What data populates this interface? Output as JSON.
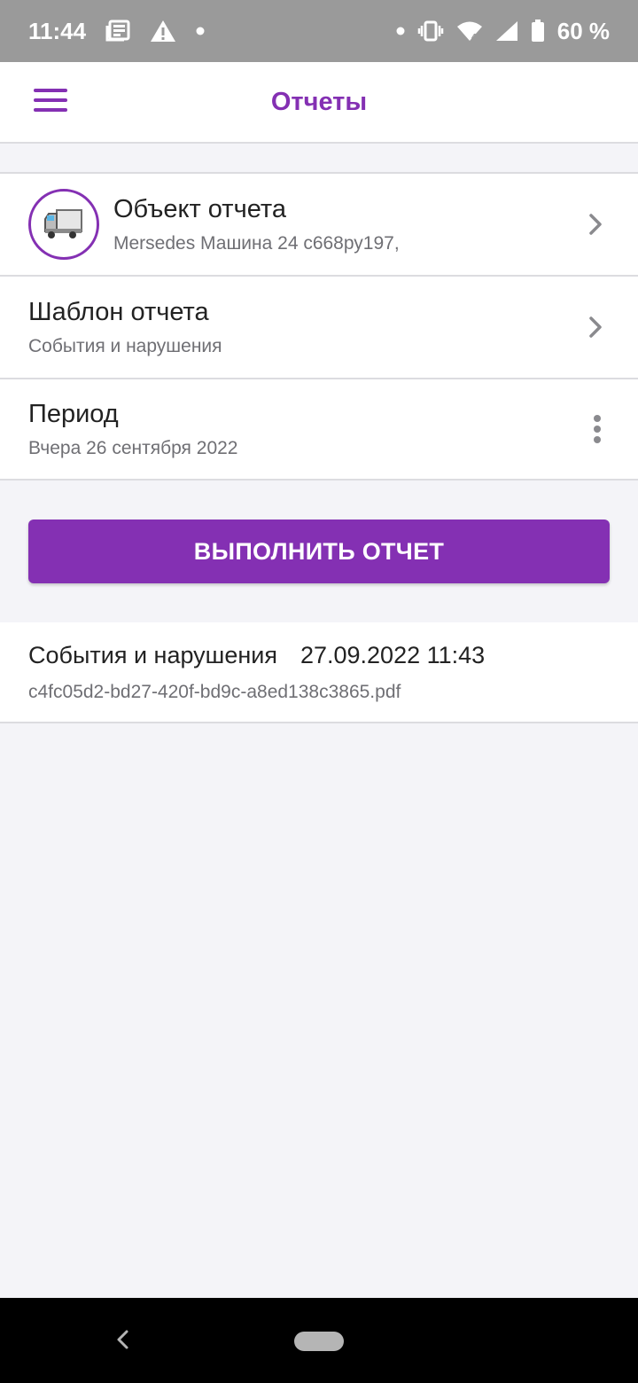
{
  "status_bar": {
    "time": "11:44",
    "battery": "60 %",
    "icons": [
      "news-icon",
      "warning-icon",
      "dot-icon",
      "vibrate-icon",
      "wifi-icon",
      "signal-icon",
      "battery-icon"
    ]
  },
  "header": {
    "title": "Отчеты",
    "menu_icon": "hamburger-icon"
  },
  "settings": {
    "object": {
      "title": "Объект отчета",
      "subtitle": "Mersedes Машина 24 с668ру197,",
      "icon": "truck-icon"
    },
    "template": {
      "title": "Шаблон отчета",
      "subtitle": "События и нарушения"
    },
    "period": {
      "title": "Период",
      "subtitle": "Вчера 26 сентября 2022"
    }
  },
  "actions": {
    "run_label": "ВЫПОЛНИТЬ ОТЧЕТ"
  },
  "reports": [
    {
      "name": "События и нарушения",
      "datetime": "27.09.2022 11:43",
      "file": "c4fc05d2-bd27-420f-bd9c-a8ed138c3865.pdf"
    }
  ],
  "colors": {
    "accent": "#8430b3",
    "background": "#f4f4f8",
    "status_bar": "#9a9a9a",
    "divider": "#dcdce0"
  }
}
